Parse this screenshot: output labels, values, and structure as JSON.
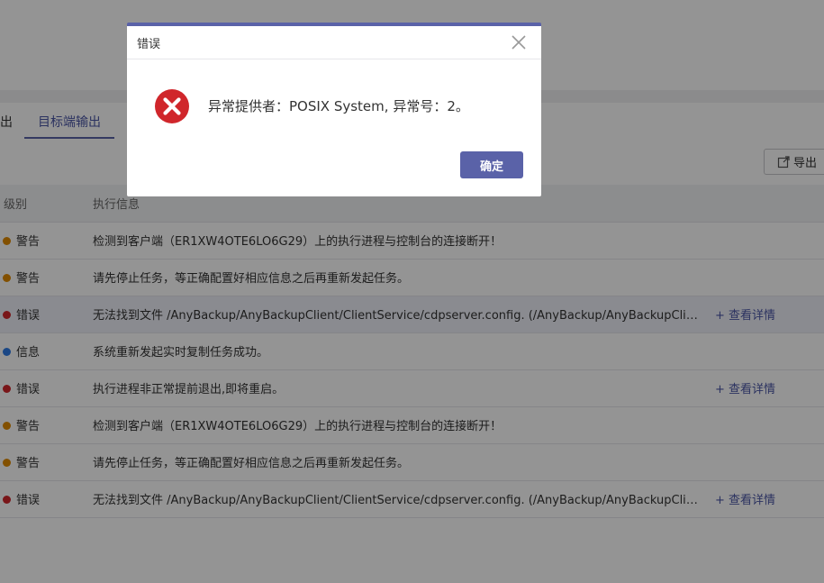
{
  "tabs": {
    "prev_label": "出",
    "active_label": "目标端输出"
  },
  "toolbar": {
    "export_label": "导出"
  },
  "table": {
    "headers": {
      "level": "级别",
      "info": "执行信息"
    },
    "rows": [
      {
        "level": "警告",
        "color": "#e08a00",
        "message": "检测到客户端（ER1XW4OTE6LO6G29）上的执行进程与控制台的连接断开！",
        "detail": ""
      },
      {
        "level": "警告",
        "color": "#e08a00",
        "message": "请先停止任务，等正确配置好相应信息之后再重新发起任务。",
        "detail": ""
      },
      {
        "level": "错误",
        "color": "#d0262b",
        "message": "无法找到文件 /AnyBackup/AnyBackupClient/ClientService/cdpserver.config. (/AnyBackup/AnyBackupClient/ClientService/cdpserver.config)",
        "detail": "+ 查看详情"
      },
      {
        "level": "信息",
        "color": "#2e7be6",
        "message": "系统重新发起实时复制任务成功。",
        "detail": ""
      },
      {
        "level": "错误",
        "color": "#d0262b",
        "message": "执行进程非正常提前退出,即将重启。",
        "detail": "+ 查看详情"
      },
      {
        "level": "警告",
        "color": "#e08a00",
        "message": "检测到客户端（ER1XW4OTE6LO6G29）上的执行进程与控制台的连接断开！",
        "detail": ""
      },
      {
        "level": "警告",
        "color": "#e08a00",
        "message": "请先停止任务，等正确配置好相应信息之后再重新发起任务。",
        "detail": ""
      },
      {
        "level": "错误",
        "color": "#d0262b",
        "message": "无法找到文件 /AnyBackup/AnyBackupClient/ClientService/cdpserver.config. (/AnyBackup/AnyBackupClient/ClientService/cdpserver.config)",
        "detail": "+ 查看详情"
      }
    ]
  },
  "dialog": {
    "title": "错误",
    "message": "异常提供者：POSIX System, 异常号：2。",
    "ok_label": "确定",
    "icon": "error-icon"
  },
  "colors": {
    "accent": "#5a62a8",
    "error": "#d0262b",
    "warning": "#e08a00",
    "info": "#2e7be6"
  }
}
